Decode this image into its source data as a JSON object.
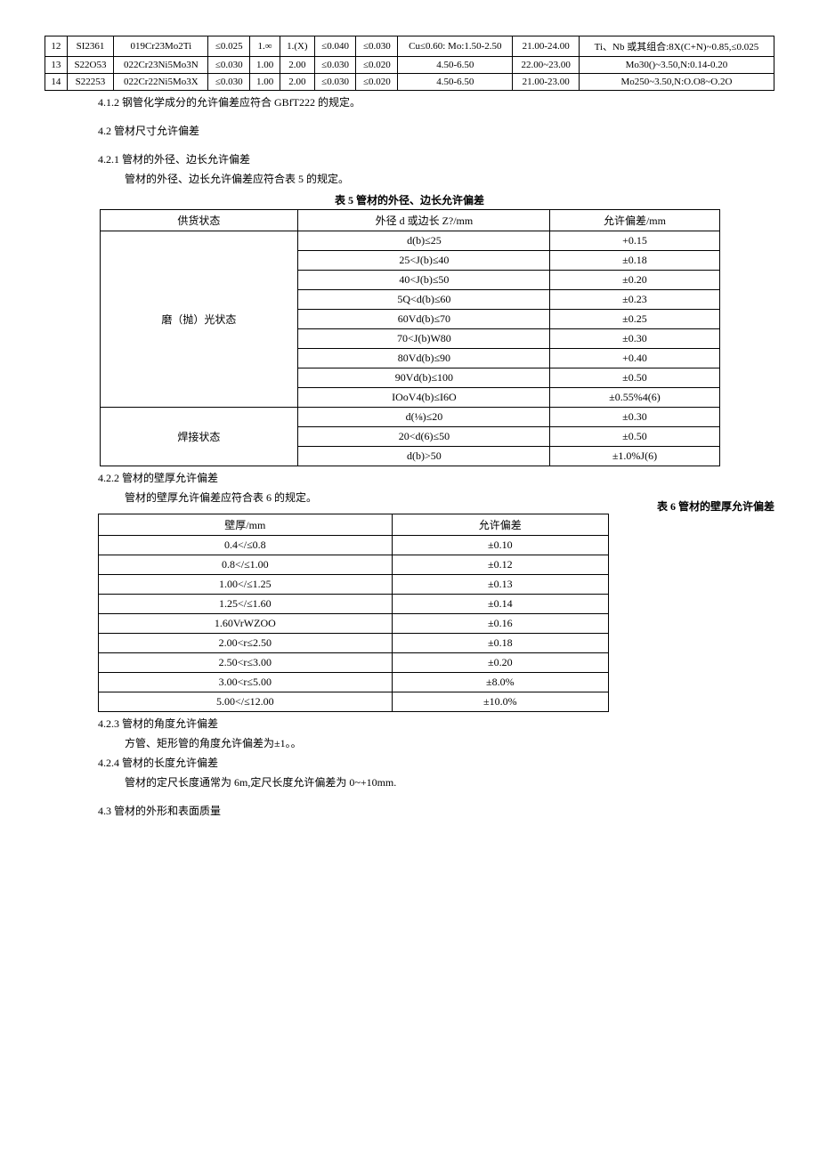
{
  "chem_rows": [
    {
      "no": "12",
      "code": "SI2361",
      "grade": "019Cr23Mo2Ti",
      "c": "≤0.025",
      "si": "1.∞",
      "mn": "1.(X)",
      "p": "≤0.040",
      "s": "≤0.030",
      "ni": "Cu≤0.60: Mo:1.50-2.50",
      "cr": "21.00-24.00",
      "other": "Ti、Nb 或其组合:8X(C+N)~0.85,≤0.025"
    },
    {
      "no": "13",
      "code": "S22O53",
      "grade": "022Cr23Ni5Mo3N",
      "c": "≤0.030",
      "si": "1.00",
      "mn": "2.00",
      "p": "≤0.030",
      "s": "≤0.020",
      "ni": "4.50-6.50",
      "cr": "22.00~23.00",
      "other": "Mo30()~3.50,N:0.14-0.20"
    },
    {
      "no": "14",
      "code": "S22253",
      "grade": "022Cr22Ni5Mo3X",
      "c": "≤0.030",
      "si": "1.00",
      "mn": "2.00",
      "p": "≤0.030",
      "s": "≤0.020",
      "ni": "4.50-6.50",
      "cr": "21.00-23.00",
      "other": "Mo250~3.50,N:O.O8~O.2O"
    }
  ],
  "p412": "4.1.2 钢管化学成分的允许偏差应符合 GBfT222 的规定。",
  "p42": "4.2 管材尺寸允许偏差",
  "p421": "4.2.1 管材的外径、边长允许偏差",
  "p421_sub": "管材的外径、边长允许偏差应符合表 5 的规定。",
  "table5_title": "表 5 管材的外径、边长允许偏差",
  "table5_headers": {
    "state": "供货状态",
    "dim": "外径 d 或边长 Z?/mm",
    "tol": "允许偏差/mm"
  },
  "table5_polished_state": "磨（抛）光状态",
  "table5_polished": [
    {
      "dim": "d(b)≤25",
      "tol": "+0.15"
    },
    {
      "dim": "25<J(b)≤40",
      "tol": "±0.18"
    },
    {
      "dim": "40<J(b)≤50",
      "tol": "±0.20"
    },
    {
      "dim": "5Q<d(b)≤60",
      "tol": "±0.23"
    },
    {
      "dim": "60Vd(b)≤70",
      "tol": "±0.25"
    },
    {
      "dim": "70<J(b)W80",
      "tol": "±0.30"
    },
    {
      "dim": "80Vd(b)≤90",
      "tol": "+0.40"
    },
    {
      "dim": "90Vd(b)≤100",
      "tol": "±0.50"
    },
    {
      "dim": "IOoV4(b)≤I6O",
      "tol": "±0.55%4(6)"
    }
  ],
  "table5_welded_state": "焊接状态",
  "table5_welded": [
    {
      "dim": "d(⅛)≤20",
      "tol": "±0.30"
    },
    {
      "dim": "20<d(6)≤50",
      "tol": "±0.50"
    },
    {
      "dim": "d(b)>50",
      "tol": "±1.0%J(6)"
    }
  ],
  "p422": "4.2.2 管材的壁厚允许偏差",
  "p422_sub": "管材的壁厚允许偏差应符合表 6 的规定。",
  "table6_title": "表 6 管材的壁厚允许偏差",
  "table6_headers": {
    "thick": "壁厚/mm",
    "tol": "允许偏差"
  },
  "table6_rows": [
    {
      "t": "0.4</≤0.8",
      "tol": "±0.10"
    },
    {
      "t": "0.8</≤1.00",
      "tol": "±0.12"
    },
    {
      "t": "1.00</≤1.25",
      "tol": "±0.13"
    },
    {
      "t": "1.25</≤1.60",
      "tol": "±0.14"
    },
    {
      "t": "1.60VrWZOO",
      "tol": "±0.16"
    },
    {
      "t": "2.00<r≤2.50",
      "tol": "±0.18"
    },
    {
      "t": "2.50<r≤3.00",
      "tol": "±0.20"
    },
    {
      "t": "3.00<r≤5.00",
      "tol": "±8.0%"
    },
    {
      "t": "5.00</≤12.00",
      "tol": "±10.0%"
    }
  ],
  "p423": "4.2.3 管材的角度允许偏差",
  "p423_sub": "方管、矩形管的角度允许偏差为±1。。",
  "p424": "4.2.4 管材的长度允许偏差",
  "p424_sub": "管材的定尺长度通常为 6m,定尺长度允许偏差为 0~+10mm.",
  "p43": "4.3 管材的外形和表面质量"
}
